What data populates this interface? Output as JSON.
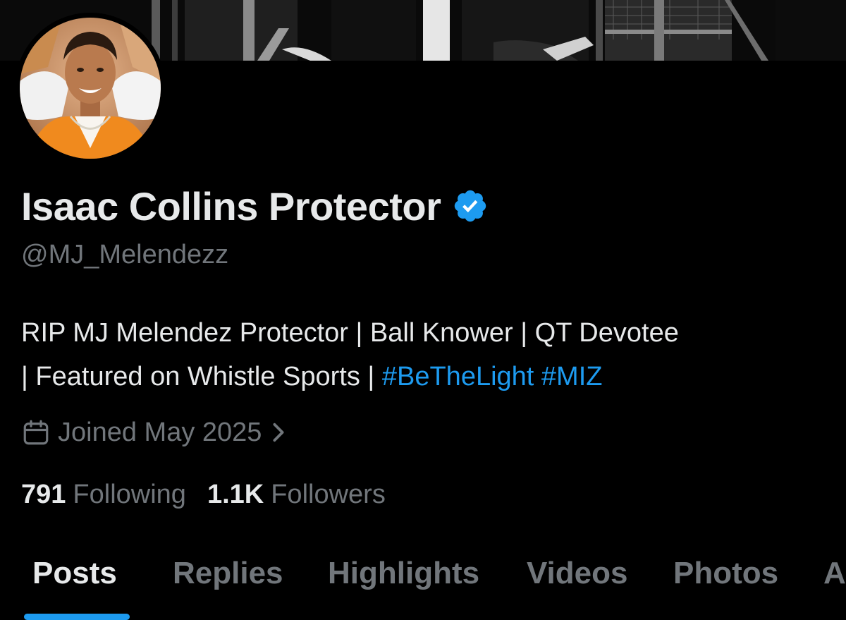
{
  "profile": {
    "display_name": "Isaac Collins Protector",
    "handle": "@MJ_Melendezz",
    "verified": true,
    "bio": {
      "line1": "RIP MJ Melendez Protector | Ball Knower | QT Devotee",
      "line2_text": "| Featured on Whistle Sports | ",
      "hashtag1": "#BeTheLight",
      "hashtag2": "#MIZ"
    },
    "joined": "Joined May 2025",
    "stats": {
      "following_count": "791",
      "following_label": "Following",
      "followers_count": "1.1K",
      "followers_label": "Followers"
    }
  },
  "tabs": [
    {
      "label": "Posts",
      "active": true
    },
    {
      "label": "Replies",
      "active": false
    },
    {
      "label": "Highlights",
      "active": false
    },
    {
      "label": "Videos",
      "active": false
    },
    {
      "label": "Photos",
      "active": false
    },
    {
      "label": "A",
      "active": false
    }
  ],
  "icons": {
    "verified": "verified-badge-icon",
    "calendar": "calendar-icon",
    "chevron": "chevron-right-icon"
  },
  "colors": {
    "background": "#000000",
    "text_primary": "#e7e9ea",
    "text_secondary": "#71767b",
    "accent": "#1d9bf0"
  }
}
